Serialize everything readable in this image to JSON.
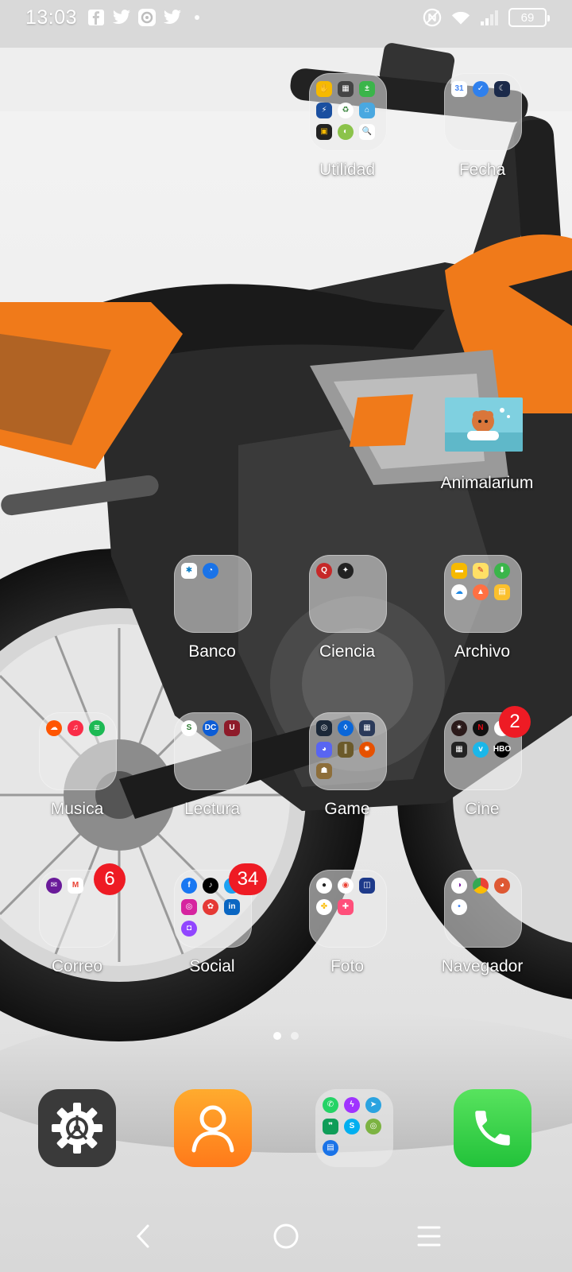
{
  "status_bar": {
    "time": "13:03",
    "notifications": [
      "facebook-icon",
      "twitter-icon",
      "camera-app-icon",
      "twitter-icon"
    ],
    "battery_level": "69",
    "system_icons": [
      "nfc-icon",
      "wifi-icon",
      "signal-icon",
      "battery-icon"
    ]
  },
  "home": {
    "folders": [
      {
        "id": "utilidad",
        "label": "Utilidad",
        "badge": null
      },
      {
        "id": "fecha",
        "label": "Fecha",
        "badge": null
      },
      {
        "id": "animalarium",
        "label": "Animalarium",
        "badge": null
      },
      {
        "id": "banco",
        "label": "Banco",
        "badge": null
      },
      {
        "id": "ciencia",
        "label": "Ciencia",
        "badge": null
      },
      {
        "id": "archivo",
        "label": "Archivo",
        "badge": null
      },
      {
        "id": "musica",
        "label": "Musica",
        "badge": null
      },
      {
        "id": "lectura",
        "label": "Lectura",
        "badge": null
      },
      {
        "id": "game",
        "label": "Game",
        "badge": null
      },
      {
        "id": "cine",
        "label": "Cine",
        "badge": "2"
      },
      {
        "id": "correo",
        "label": "Correo",
        "badge": "6"
      },
      {
        "id": "social",
        "label": "Social",
        "badge": "34"
      },
      {
        "id": "foto",
        "label": "Foto",
        "badge": null
      },
      {
        "id": "navegador",
        "label": "Navegador",
        "badge": null
      }
    ]
  },
  "pager": {
    "pages": 2,
    "current": 1
  },
  "dock": {
    "apps": [
      "settings-app",
      "contacts-app",
      "messaging-folder",
      "phone-app"
    ]
  },
  "nav": {
    "buttons": [
      "back",
      "home",
      "recents"
    ]
  },
  "colors": {
    "badge": "#ee1b24",
    "phone_green": "#3cd34a",
    "contacts_orange": "#ff8c1a",
    "settings_gray": "#3c3c3c",
    "bike_orange": "#f07a1a"
  }
}
